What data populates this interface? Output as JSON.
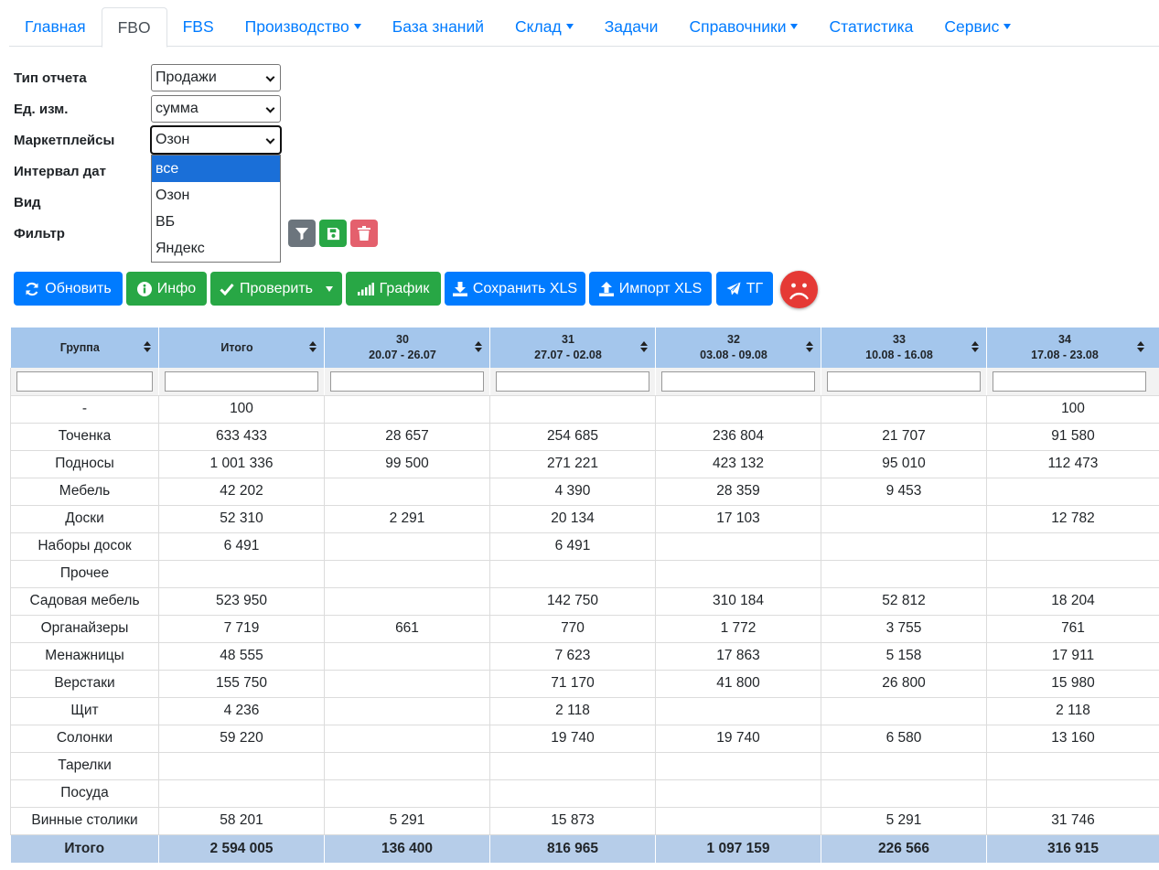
{
  "nav": {
    "items": [
      {
        "label": "Главная",
        "active": false,
        "dropdown": false
      },
      {
        "label": "FBO",
        "active": true,
        "dropdown": false
      },
      {
        "label": "FBS",
        "active": false,
        "dropdown": false
      },
      {
        "label": "Производство",
        "active": false,
        "dropdown": true
      },
      {
        "label": "База знаний",
        "active": false,
        "dropdown": false
      },
      {
        "label": "Склад",
        "active": false,
        "dropdown": true
      },
      {
        "label": "Задачи",
        "active": false,
        "dropdown": false
      },
      {
        "label": "Справочники",
        "active": false,
        "dropdown": true
      },
      {
        "label": "Статистика",
        "active": false,
        "dropdown": false
      },
      {
        "label": "Сервис",
        "active": false,
        "dropdown": true
      }
    ]
  },
  "form": {
    "report_type": {
      "label": "Тип отчета",
      "value": "Продажи"
    },
    "unit": {
      "label": "Ед. изм.",
      "value": "сумма"
    },
    "marketplaces": {
      "label": "Маркетплейсы",
      "value": "Озон",
      "options": [
        "все",
        "Озон",
        "ВБ",
        "Яндекс"
      ],
      "highlighted": "все"
    },
    "date_interval": {
      "label": "Интервал дат"
    },
    "view": {
      "label": "Вид"
    },
    "filter": {
      "label": "Фильтр"
    }
  },
  "toolbar": {
    "refresh": "Обновить",
    "info": "Инфо",
    "check": "Проверить",
    "chart": "График",
    "save_xls": "Сохранить XLS",
    "import_xls": "Импорт XLS",
    "tg": "ТГ"
  },
  "table": {
    "columns": [
      {
        "line1": "Группа",
        "line2": ""
      },
      {
        "line1": "Итого",
        "line2": ""
      },
      {
        "line1": "30",
        "line2": "20.07 - 26.07"
      },
      {
        "line1": "31",
        "line2": "27.07 - 02.08"
      },
      {
        "line1": "32",
        "line2": "03.08 - 09.08"
      },
      {
        "line1": "33",
        "line2": "10.08 - 16.08"
      },
      {
        "line1": "34",
        "line2": "17.08 - 23.08"
      }
    ],
    "rows": [
      [
        "-",
        "100",
        "",
        "",
        "",
        "",
        "100"
      ],
      [
        "Точенка",
        "633 433",
        "28 657",
        "254 685",
        "236 804",
        "21 707",
        "91 580"
      ],
      [
        "Подносы",
        "1 001 336",
        "99 500",
        "271 221",
        "423 132",
        "95 010",
        "112 473"
      ],
      [
        "Мебель",
        "42 202",
        "",
        "4 390",
        "28 359",
        "9 453",
        ""
      ],
      [
        "Доски",
        "52 310",
        "2 291",
        "20 134",
        "17 103",
        "",
        "12 782"
      ],
      [
        "Наборы досок",
        "6 491",
        "",
        "6 491",
        "",
        "",
        ""
      ],
      [
        "Прочее",
        "",
        "",
        "",
        "",
        "",
        ""
      ],
      [
        "Садовая мебель",
        "523 950",
        "",
        "142 750",
        "310 184",
        "52 812",
        "18 204"
      ],
      [
        "Органайзеры",
        "7 719",
        "661",
        "770",
        "1 772",
        "3 755",
        "761"
      ],
      [
        "Менажницы",
        "48 555",
        "",
        "7 623",
        "17 863",
        "5 158",
        "17 911"
      ],
      [
        "Верстаки",
        "155 750",
        "",
        "71 170",
        "41 800",
        "26 800",
        "15 980"
      ],
      [
        "Щит",
        "4 236",
        "",
        "2 118",
        "",
        "",
        "2 118"
      ],
      [
        "Солонки",
        "59 220",
        "",
        "19 740",
        "19 740",
        "6 580",
        "13 160"
      ],
      [
        "Тарелки",
        "",
        "",
        "",
        "",
        "",
        ""
      ],
      [
        "Посуда",
        "",
        "",
        "",
        "",
        "",
        ""
      ],
      [
        "Винные столики",
        "58 201",
        "5 291",
        "15 873",
        "",
        "5 291",
        "31 746"
      ]
    ],
    "total": [
      "Итого",
      "2 594 005",
      "136 400",
      "816 965",
      "1 097 159",
      "226 566",
      "316 915"
    ]
  },
  "colors": {
    "primary": "#007bff",
    "success": "#28a745",
    "secondary": "#6c757d",
    "danger_light": "#e4606d",
    "header_bg": "#a4c6ec",
    "total_bg": "#b6cde9",
    "sad_face": "#e53935"
  }
}
